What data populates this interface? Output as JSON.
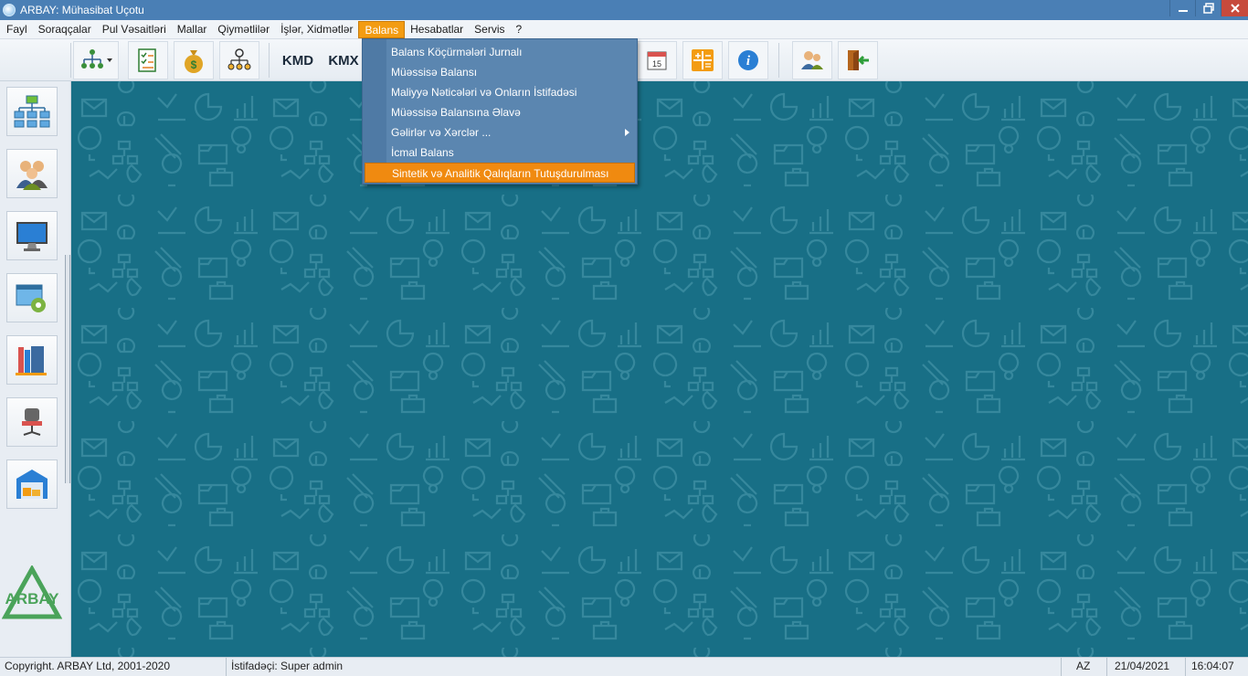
{
  "window": {
    "title": "ARBAY: Mühasibat Uçotu"
  },
  "menubar": {
    "items": [
      "Fayl",
      "Soraqçalar",
      "Pul Vəsaitləri",
      "Mallar",
      "Qiymətlilər",
      "İşlər, Xidmətlər",
      "Balans",
      "Hesabatlar",
      "Servis",
      "?"
    ],
    "active": "Balans"
  },
  "toolbar": {
    "kmd_label": "KMD",
    "kmx_label": "KMX",
    "icons": [
      "org-structure-icon",
      "checklist-icon",
      "money-bag-icon",
      "people-network-icon",
      "calendar-icon",
      "calculator-icon",
      "info-icon",
      "users-icon",
      "exit-door-icon"
    ],
    "calendar_day": "15"
  },
  "dropdown": {
    "items": [
      "Balans Köçürmələri Jurnalı",
      "Müəssisə Balansı",
      "Maliyyə Nəticələri və Onların İstifadəsi",
      "Müəssisə Balansına Əlavə",
      "Gəlirlər və Xərclər ...",
      "İcmal Balans",
      "Sintetik və Analitik Qalıqların Tutuşdurulması"
    ],
    "highlighted_index": 6,
    "submenu_index": 4
  },
  "leftpanel": {
    "icons": [
      "org-chart-icon",
      "users-group-icon",
      "monitor-icon",
      "settings-window-icon",
      "books-icon",
      "office-chair-icon",
      "warehouse-icon"
    ],
    "logo_text": "ARBAY"
  },
  "statusbar": {
    "copyright": "Copyright. ARBAY Ltd, 2001-2020",
    "user": "İstifadəçi: Super admin",
    "lang": "AZ",
    "date": "21/04/2021",
    "time": "16:04:07"
  },
  "colors": {
    "workspace_bg": "#186f86",
    "menu_active": "#f39c12",
    "dropdown_bg": "#5b86b0",
    "dropdown_highlight": "#f08a10"
  }
}
